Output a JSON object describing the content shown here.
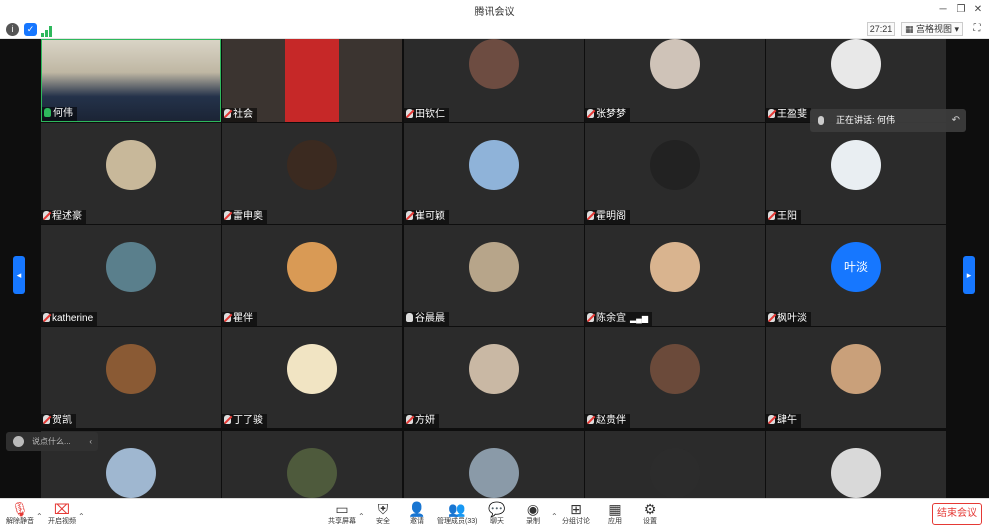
{
  "window": {
    "title": "腾讯会议"
  },
  "infobar": {
    "timer": "27:21",
    "view_label": "宫格视图"
  },
  "speaking": {
    "text": "正在讲话: 何伟"
  },
  "chat": {
    "placeholder": "说点什么..."
  },
  "participants": [
    {
      "name": "何伟",
      "muted": false
    },
    {
      "name": "社会",
      "muted": true
    },
    {
      "name": "田钦仁",
      "muted": true
    },
    {
      "name": "张梦梦",
      "muted": true
    },
    {
      "name": "王盈斐",
      "muted": true
    },
    {
      "name": "程述豪",
      "muted": true
    },
    {
      "name": "雷申奥",
      "muted": true
    },
    {
      "name": "崔可颖",
      "muted": true
    },
    {
      "name": "霍明阁",
      "muted": true
    },
    {
      "name": "王阳",
      "muted": true
    },
    {
      "name": "katherine",
      "muted": true
    },
    {
      "name": "瞿伴",
      "muted": true
    },
    {
      "name": "谷晨晨",
      "muted": false
    },
    {
      "name": "陈余宜",
      "muted": true
    },
    {
      "name": "枫叶淡",
      "muted": true
    },
    {
      "name": "贺凯",
      "muted": true
    },
    {
      "name": "丁了骏",
      "muted": true
    },
    {
      "name": "方妍",
      "muted": true
    },
    {
      "name": "赵贵伴",
      "muted": true
    },
    {
      "name": "肆午",
      "muted": true
    }
  ],
  "text_avatar": "叶淡",
  "toolbar": {
    "unmute": "解除静音",
    "start_video": "开启视频",
    "share_screen": "共享屏幕",
    "security": "安全",
    "invite": "邀请",
    "manage_members": "管理成员(33)",
    "chat": "聊天",
    "record": "录制",
    "breakout": "分组讨论",
    "apps": "应用",
    "settings": "设置",
    "end_meeting": "结束会议"
  },
  "colors": {
    "accent": "#1677ff",
    "end": "#e53935",
    "tile": "#2b2b2b"
  }
}
